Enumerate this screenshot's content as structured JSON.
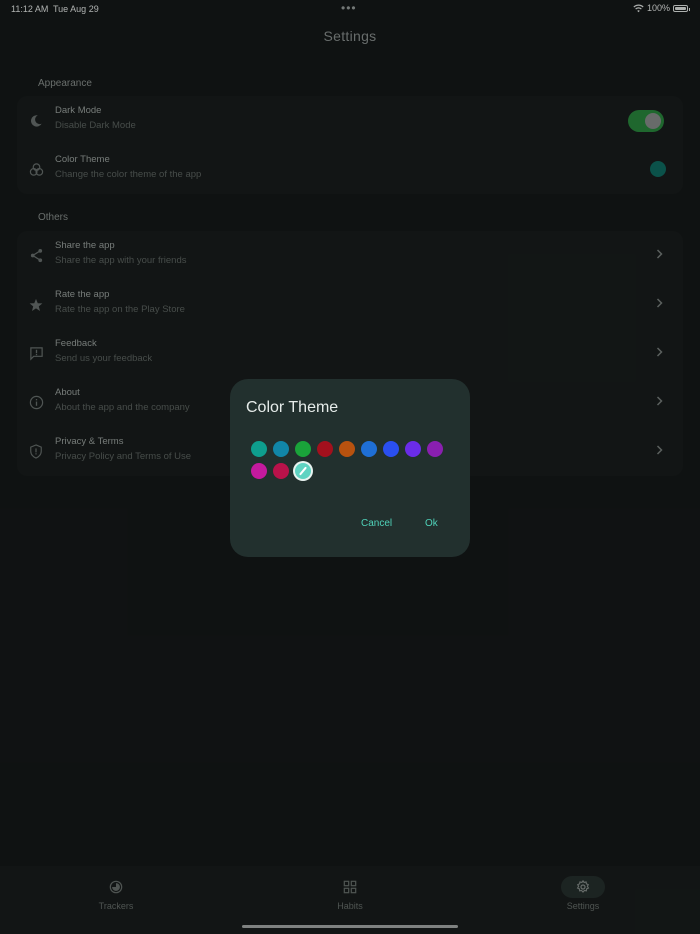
{
  "status_bar": {
    "time": "11:12 AM",
    "date": "Tue Aug 29",
    "dots": "•••",
    "battery": "100%"
  },
  "page": {
    "title": "Settings"
  },
  "appearance": {
    "section_title": "Appearance",
    "items": [
      {
        "title": "Dark Mode",
        "subtitle": "Disable Dark Mode",
        "icon": "moon-icon",
        "toggle_on": true
      },
      {
        "title": "Color Theme",
        "subtitle": "Change the color theme of the app",
        "icon": "palette-icon",
        "theme_color": "#0f6e63"
      }
    ]
  },
  "others": {
    "section_title": "Others",
    "items": [
      {
        "title": "Share the app",
        "subtitle": "Share the app with your friends",
        "icon": "share-icon"
      },
      {
        "title": "Rate the app",
        "subtitle": "Rate the app on the Play Store",
        "icon": "star-icon"
      },
      {
        "title": "Feedback",
        "subtitle": "Send us your feedback",
        "icon": "feedback-icon"
      },
      {
        "title": "About",
        "subtitle": "About the app and the company",
        "icon": "info-icon"
      },
      {
        "title": "Privacy & Terms",
        "subtitle": "Privacy Policy and Terms of Use",
        "icon": "shield-icon"
      }
    ]
  },
  "dialog": {
    "title": "Color Theme",
    "colors": [
      "#0e9e8e",
      "#1186a8",
      "#1aa33a",
      "#a3101d",
      "#b8520f",
      "#1f6fd6",
      "#2a4ff0",
      "#6a2ce8",
      "#8a1fb0",
      "#c41a9e",
      "#b8124a",
      "#5fd3c2"
    ],
    "selected_index": 11,
    "cancel_label": "Cancel",
    "ok_label": "Ok"
  },
  "bottom_nav": {
    "items": [
      {
        "label": "Trackers",
        "icon": "trackers-icon",
        "active": false
      },
      {
        "label": "Habits",
        "icon": "grid-icon",
        "active": false
      },
      {
        "label": "Settings",
        "icon": "gear-icon",
        "active": true
      }
    ]
  },
  "colors": {
    "background": "#151819",
    "card": "#181d1c",
    "accent": "#4fd1b8",
    "toggle_on": "#2a8a3e"
  }
}
